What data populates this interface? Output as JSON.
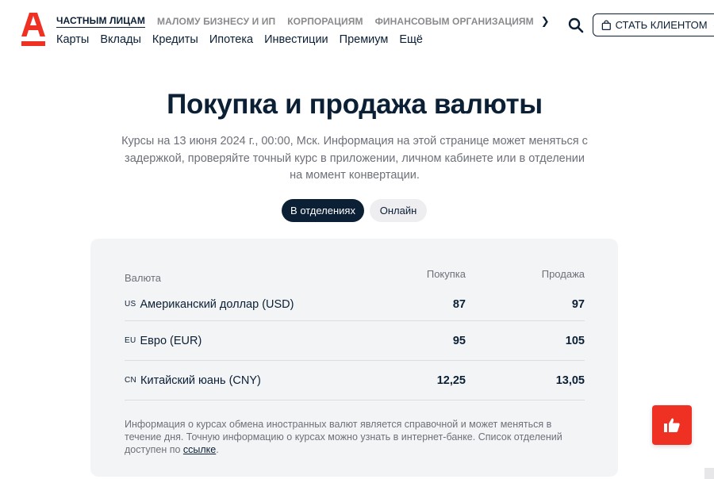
{
  "header": {
    "logo": "А",
    "segments": [
      {
        "label": "Частным лицам",
        "active": true
      },
      {
        "label": "Малому бизнесу и ИП",
        "active": false
      },
      {
        "label": "Корпорациям",
        "active": false
      },
      {
        "label": "Финансовым организациям",
        "active": false
      }
    ],
    "segments_more_icon": "chevron-right-icon",
    "products": [
      "Карты",
      "Вклады",
      "Кредиты",
      "Ипотека",
      "Инвестиции",
      "Премиум",
      "Ещё"
    ],
    "client_button_label": "СТАТЬ КЛИЕНТОМ"
  },
  "page": {
    "title": "Покупка и продажа валюты",
    "subtitle": "Курсы на 13 июня 2024 г., 00:00, Мск. Информация на этой странице может меняться с задержкой, проверяйте точный курс в приложении, личном кабинете или в отделении на момент конвертации.",
    "toggle": {
      "options": [
        "В отделениях",
        "Онлайн"
      ],
      "selected": "В отделениях"
    }
  },
  "rates": {
    "columns": {
      "currency": "Валюта",
      "buy": "Покупка",
      "sell": "Продажа"
    },
    "rows": [
      {
        "code": "US",
        "name": "Американский доллар (USD)",
        "buy": "87",
        "sell": "97"
      },
      {
        "code": "EU",
        "name": "Евро (EUR)",
        "buy": "95",
        "sell": "105"
      },
      {
        "code": "CN",
        "name": "Китайский юань (CNY)",
        "buy": "12,25",
        "sell": "13,05"
      }
    ],
    "note_text": "Информация о курсах обмена иностранных валют является справочной и может меняться в течение дня. Точную информацию о курсах можно узнать в интернет-банке. Список отделений доступен по ",
    "note_link": "ссылке",
    "note_end": "."
  },
  "colors": {
    "brand_red": "#ef3124",
    "text_dark": "#0b1f35",
    "muted": "#6d7079",
    "card_bg": "#f3f4f5"
  }
}
